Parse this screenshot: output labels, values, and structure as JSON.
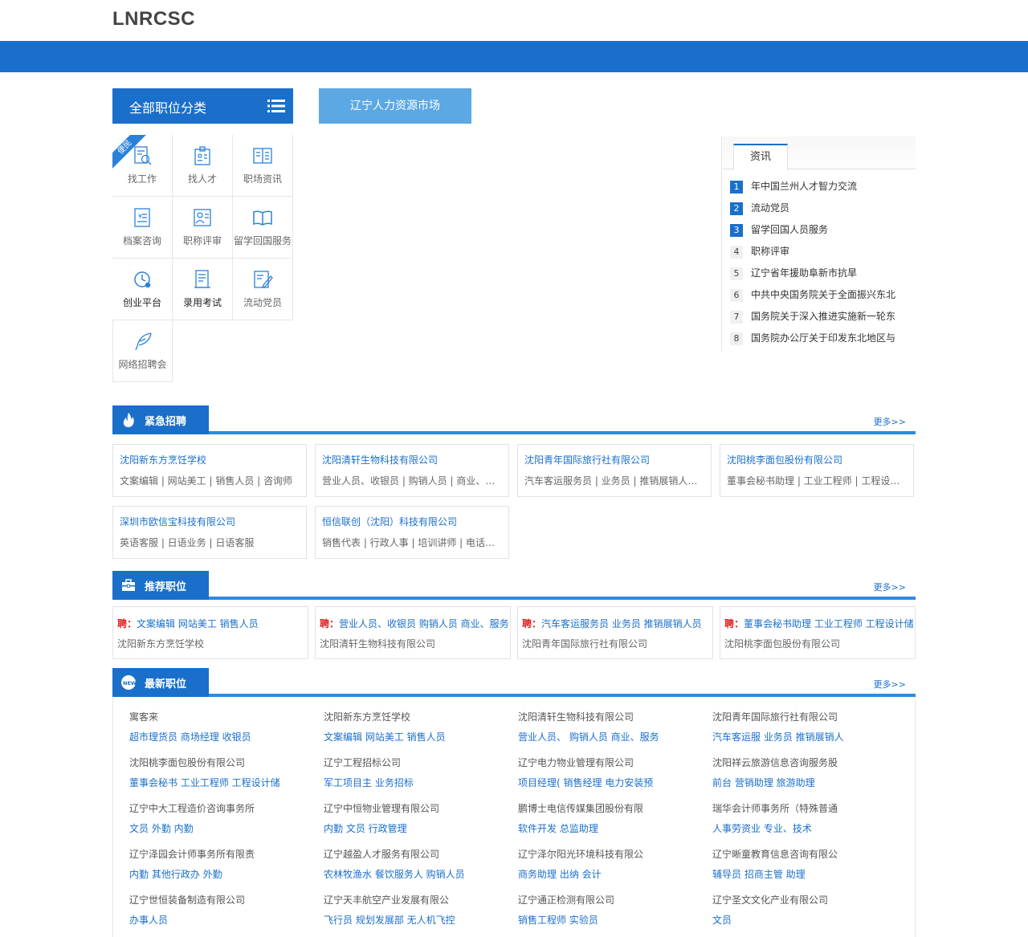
{
  "site": {
    "logo": "LNRCSC"
  },
  "categories": {
    "title": "全部职位分类",
    "market_button": "辽宁人力资源市场",
    "ribbon": "便民",
    "items": [
      {
        "label": "找工作",
        "icon": "search-doc-icon"
      },
      {
        "label": "找人才",
        "icon": "id-card-icon"
      },
      {
        "label": "职场资讯",
        "icon": "book-icon"
      },
      {
        "label": "档案咨询",
        "icon": "file-icon"
      },
      {
        "label": "职称评审",
        "icon": "person-card-icon"
      },
      {
        "label": "留学回国服务",
        "icon": "open-book-icon"
      },
      {
        "label": "创业平台",
        "icon": "clock-icon"
      },
      {
        "label": "录用考试",
        "icon": "exam-icon"
      },
      {
        "label": "流动党员",
        "icon": "edit-icon"
      },
      {
        "label": "网络招聘会",
        "icon": "feather-icon"
      }
    ]
  },
  "news": {
    "tab": "资讯",
    "items": [
      {
        "num": "1",
        "text": "年中国兰州人才智力交流"
      },
      {
        "num": "2",
        "text": "流动党员"
      },
      {
        "num": "3",
        "text": "留学回国人员服务"
      },
      {
        "num": "4",
        "text": "职称评审"
      },
      {
        "num": "5",
        "text": "辽宁省年援助阜新市抗旱"
      },
      {
        "num": "6",
        "text": "中共中央国务院关于全面振兴东北"
      },
      {
        "num": "7",
        "text": "国务院关于深入推进实施新一轮东"
      },
      {
        "num": "8",
        "text": "国务院办公厅关于印发东北地区与"
      }
    ]
  },
  "urgent": {
    "title": "紧急招聘",
    "more": "更多>>",
    "cards": [
      {
        "company": "沈阳新东方烹饪学校",
        "jobs": "文案编辑 | 网站美工 | 销售人员 | 咨询师"
      },
      {
        "company": "沈阳清轩生物科技有限公司",
        "jobs": "营业人员、收银员 | 购销人员 | 商业、服务"
      },
      {
        "company": "沈阳青年国际旅行社有限公司",
        "jobs": "汽车客运服务员 | 业务员 | 推销展销人员 | 导游"
      },
      {
        "company": "沈阳桃李面包股份有限公司",
        "jobs": "董事会秘书助理 | 工业工程师 | 工程设计储备"
      },
      {
        "company": "深圳市欧信宝科技有限公司",
        "jobs": "英语客服 | 日语业务 | 日语客服"
      },
      {
        "company": "恒信联创（沈阳）科技有限公司",
        "jobs": "销售代表 | 行政人事 | 培训讲师 | 电话销售"
      }
    ]
  },
  "recommended": {
    "title": "推荐职位",
    "more": "更多>>",
    "prefix": "聘：",
    "cards": [
      {
        "jobs": "文案编辑 网站美工 销售人员",
        "company": "沈阳新东方烹饪学校"
      },
      {
        "jobs": "营业人员、收银员 购销人员 商业、服务",
        "company": "沈阳清轩生物科技有限公司"
      },
      {
        "jobs": "汽车客运服务员 业务员 推销展销人员",
        "company": "沈阳青年国际旅行社有限公司"
      },
      {
        "jobs": "董事会秘书助理 工业工程师 工程设计储",
        "company": "沈阳桃李面包股份有限公司"
      }
    ]
  },
  "latest": {
    "title": "最新职位",
    "more": "更多>>",
    "items": [
      {
        "company": "寓客来",
        "jobs": "超市理货员 商场经理 收银员"
      },
      {
        "company": "沈阳新东方烹饪学校",
        "jobs": "文案编辑 网站美工 销售人员"
      },
      {
        "company": "沈阳清轩生物科技有限公司",
        "jobs": "营业人员、 购销人员 商业、服务"
      },
      {
        "company": "沈阳青年国际旅行社有限公司",
        "jobs": "汽车客运服 业务员 推销展销人"
      },
      {
        "company": "沈阳桃李面包股份有限公司",
        "jobs": "董事会秘书 工业工程师 工程设计储"
      },
      {
        "company": "辽宁工程招标公司",
        "jobs": "军工项目主 业务招标"
      },
      {
        "company": "辽宁电力物业管理有限公司",
        "jobs": "项目经理( 销售经理 电力安装预"
      },
      {
        "company": "沈阳祥云旅游信息咨询服务股",
        "jobs": "前台 营销助理 旅游助理"
      },
      {
        "company": "辽宁中大工程造价咨询事务所",
        "jobs": "文员 外勤 内勤"
      },
      {
        "company": "辽宁中恒物业管理有限公司",
        "jobs": "内勤 文员 行政管理"
      },
      {
        "company": "鹏博士电信传媒集团股份有限",
        "jobs": "软件开发 总监助理"
      },
      {
        "company": "瑞华会计师事务所（特殊普通",
        "jobs": "人事劳资业 专业、技术"
      },
      {
        "company": "辽宁泽园会计师事务所有限责",
        "jobs": "内勤 其他行政办 外勤"
      },
      {
        "company": "辽宁越盈人才服务有限公司",
        "jobs": "农林牧渔水 餐饮服务人 购销人员"
      },
      {
        "company": "辽宁泽尔阳光环境科技有限公",
        "jobs": "商务助理 出纳 会计"
      },
      {
        "company": "辽宁晰童教育信息咨询有限公",
        "jobs": "辅导员 招商主管 助理"
      },
      {
        "company": "辽宁世恒装备制造有限公司",
        "jobs": "办事人员"
      },
      {
        "company": "辽宁天丰航空产业发展有限公",
        "jobs": "飞行员 规划发展部 无人机飞控"
      },
      {
        "company": "辽宁通正检测有限公司",
        "jobs": "销售工程师 实验员"
      },
      {
        "company": "辽宁圣文文化产业有限公司",
        "jobs": "文员"
      }
    ]
  },
  "colors": {
    "brand": "#1a6fcb",
    "accent_light": "#5ba8e4",
    "hot_red": "#e02020"
  }
}
